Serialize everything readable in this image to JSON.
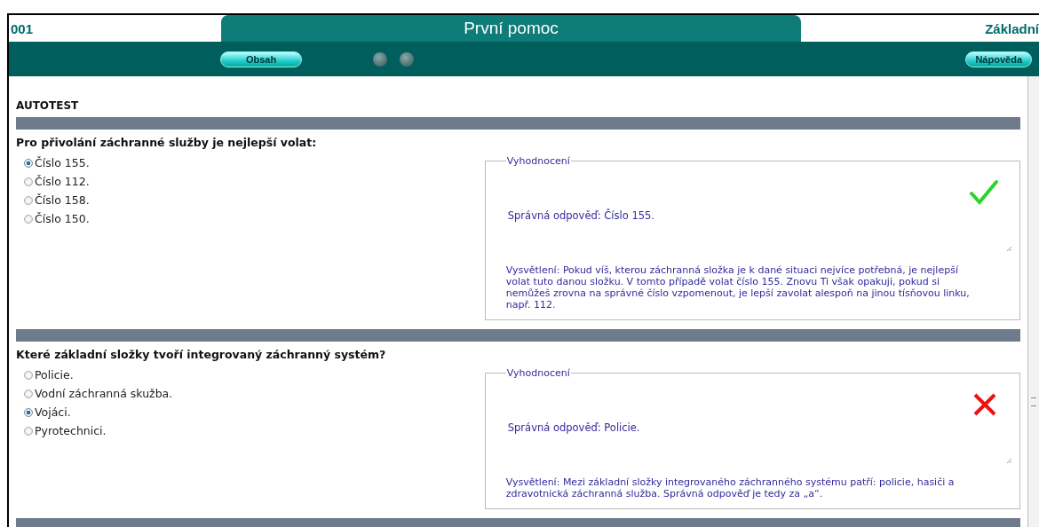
{
  "header": {
    "code": "001",
    "title": "První pomoc",
    "right_title": "Základní"
  },
  "toolbar": {
    "buttons": [
      {
        "label": "Obsah"
      },
      {
        "label": "Nápověda"
      }
    ]
  },
  "section_title": "AUTOTEST",
  "questions": [
    {
      "text": "Pro přivolání záchranné služby je nejlepší volat:",
      "options": [
        {
          "label": "Číslo 155.",
          "selected": true
        },
        {
          "label": "Číslo 112.",
          "selected": false
        },
        {
          "label": "Číslo 158.",
          "selected": false
        },
        {
          "label": "Číslo 150.",
          "selected": false
        }
      ],
      "evaluation": {
        "legend": "Vyhodnocení",
        "kind": "correct",
        "answer": "Správná odpověď: Číslo 155.",
        "explanation": "Vysvětlení: Pokud víš, kterou záchranná složka je k dané situaci nejvíce potřebná, je nejlepší volat tuto danou složku. V tomto případě volat číslo 155. Znovu Ti však opakuji, pokud si nemůžeš zrovna na správné číslo vzpomenout, je lepší zavolat alespoň na jinou tísňovou linku, např. 112."
      }
    },
    {
      "text": "Které základní složky tvoří integrovaný záchranný systém?",
      "options": [
        {
          "label": "Policie.",
          "selected": false
        },
        {
          "label": "Vodní záchranná skužba.",
          "selected": false
        },
        {
          "label": "Vojáci.",
          "selected": true
        },
        {
          "label": "Pyrotechnici.",
          "selected": false
        }
      ],
      "evaluation": {
        "legend": "Vyhodnocení",
        "kind": "wrong",
        "answer": "Správná odpověď: Policie.",
        "explanation": "Vysvětlení: Mezi základní složky integrovaného záchranného systému patří: policie, hasiči a zdravotnická záchranná služba. Správná odpověď je tedy za „a“."
      }
    }
  ]
}
